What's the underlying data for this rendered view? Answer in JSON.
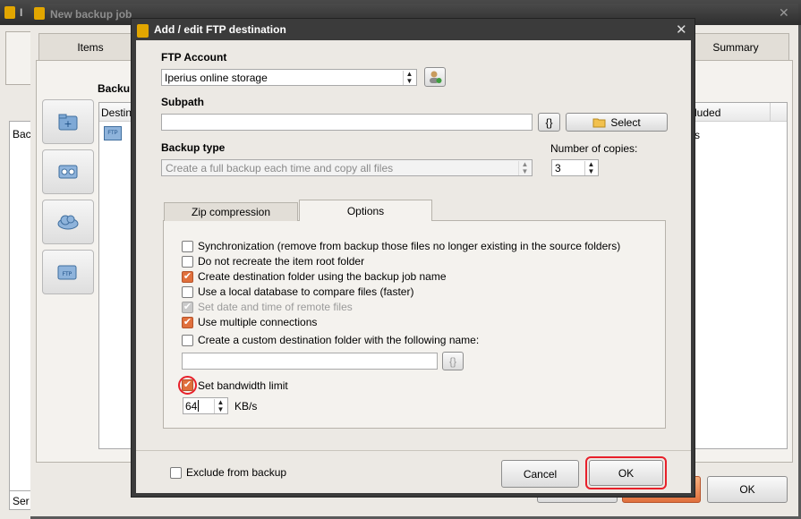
{
  "bg_window": {
    "title": "New backup job",
    "tabs": {
      "items": "Items",
      "summary": "Summary"
    },
    "section_title": "Backu",
    "col_destination": "Destina",
    "col_excluded": "luded",
    "row_frag": "s",
    "left_frag_1": "Bac",
    "left_frag_2": "Ser",
    "ok_label": "OK"
  },
  "dialog": {
    "title": "Add / edit FTP destination",
    "ftp_account": {
      "label": "FTP Account",
      "value": "Iperius online storage"
    },
    "subpath": {
      "label": "Subpath",
      "value": "",
      "brace_label": "{}",
      "select_label": "Select"
    },
    "backup_type": {
      "label": "Backup type",
      "value": "Create a full backup each time and copy all files"
    },
    "copies": {
      "label": "Number of copies:",
      "value": "3"
    },
    "tabs": {
      "zip": "Zip compression",
      "options": "Options"
    },
    "options": [
      {
        "label": "Synchronization (remove from backup those files no longer existing in the source folders)",
        "checked": false,
        "enabled": true
      },
      {
        "label": "Do not recreate the item root folder",
        "checked": false,
        "enabled": true
      },
      {
        "label": "Create destination folder using the backup job name",
        "checked": true,
        "enabled": true
      },
      {
        "label": "Use a local database to compare files (faster)",
        "checked": false,
        "enabled": true
      },
      {
        "label": "Set date and time of remote files",
        "checked": true,
        "enabled": false
      },
      {
        "label": "Use multiple connections",
        "checked": true,
        "enabled": true
      },
      {
        "label": "Create a custom destination folder with the following name:",
        "checked": false,
        "enabled": true
      }
    ],
    "custom_folder": {
      "value": "",
      "brace_label": "{}"
    },
    "bandwidth": {
      "label": "Set bandwidth limit",
      "checked": true,
      "value": "64",
      "unit": "KB/s"
    },
    "exclude": {
      "label": "Exclude from backup",
      "checked": false
    },
    "buttons": {
      "cancel": "Cancel",
      "ok": "OK"
    }
  },
  "colors": {
    "accent_orange": "#e0703d",
    "highlight_red": "#e8202a"
  }
}
